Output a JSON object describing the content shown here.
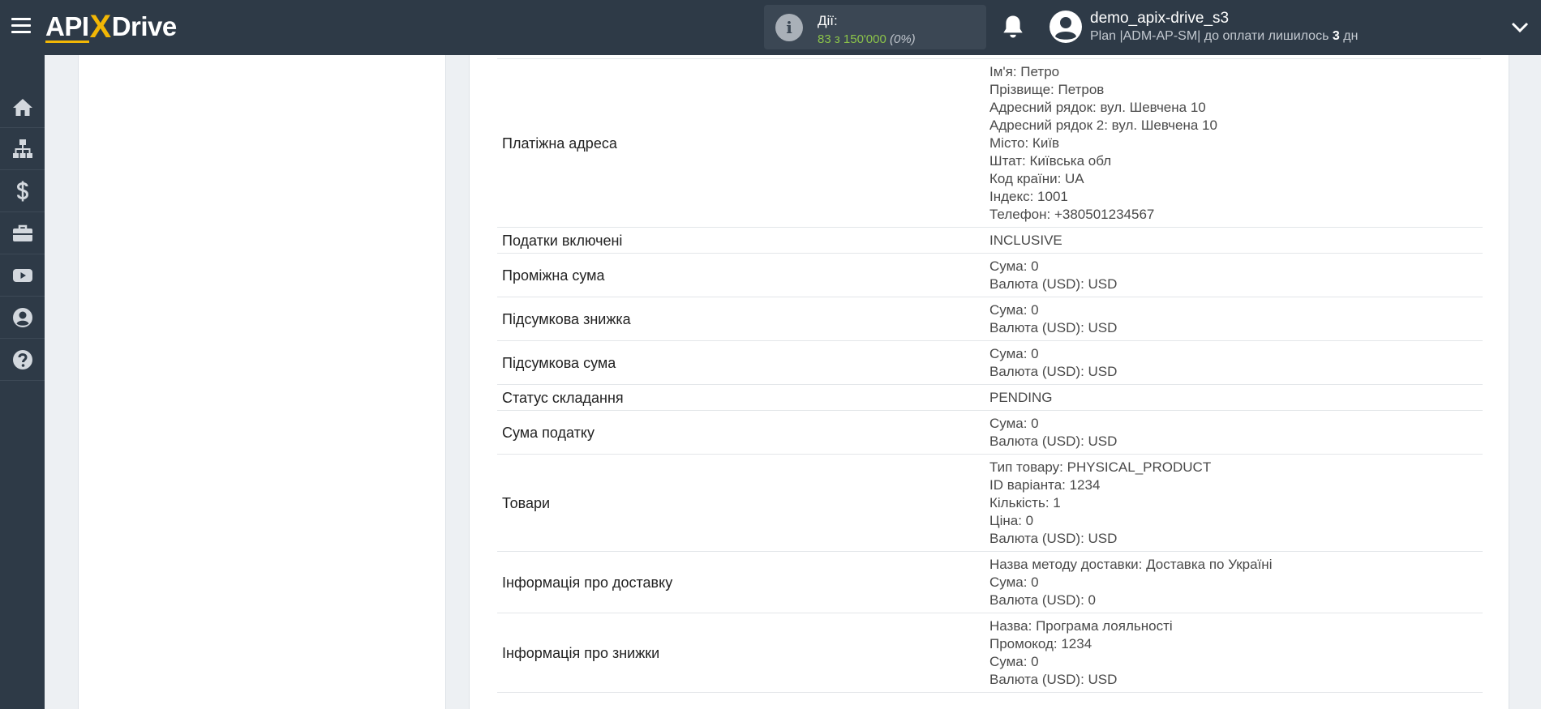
{
  "header": {
    "logo_left": "API",
    "logo_x": "X",
    "logo_right": "Drive",
    "actions_label": "Дії:",
    "actions_value": "83 з 150'000",
    "actions_percent": "(0%)",
    "username": "demo_apix-drive_s3",
    "plan_text": "Plan |ADM-AP-SM| до оплати лишилось",
    "plan_days": "3",
    "plan_suffix": "дн"
  },
  "sidebar": {
    "items": [
      {
        "icon": "home-icon"
      },
      {
        "icon": "sitemap-icon"
      },
      {
        "icon": "dollar-icon"
      },
      {
        "icon": "briefcase-icon"
      },
      {
        "icon": "youtube-icon"
      },
      {
        "icon": "user-circle-icon"
      },
      {
        "icon": "help-icon"
      }
    ]
  },
  "rows": [
    {
      "label": "Платіжна адреса",
      "values": [
        "Ім'я: Петро",
        "Прізвище: Петров",
        "Адресний рядок: вул. Шевчена 10",
        "Адресний рядок 2: вул. Шевчена 10",
        "Місто: Київ",
        "Штат: Київська обл",
        "Код країни: UA",
        "Індекс: 1001",
        "Телефон: +380501234567"
      ]
    },
    {
      "label": "Податки включені",
      "values": [
        "INCLUSIVE"
      ]
    },
    {
      "label": "Проміжна сума",
      "values": [
        "Сума: 0",
        "Валюта (USD): USD"
      ]
    },
    {
      "label": "Підсумкова знижка",
      "values": [
        "Сума: 0",
        "Валюта (USD): USD"
      ]
    },
    {
      "label": "Підсумкова сума",
      "values": [
        "Сума: 0",
        "Валюта (USD): USD"
      ]
    },
    {
      "label": "Статус складання",
      "values": [
        "PENDING"
      ]
    },
    {
      "label": "Сума податку",
      "values": [
        "Сума: 0",
        "Валюта (USD): USD"
      ]
    },
    {
      "label": "Товари",
      "values": [
        "Тип товару: PHYSICAL_PRODUCT",
        "ID варіанта: 1234",
        "Кількість: 1",
        "Ціна: 0",
        "Валюта (USD): USD"
      ]
    },
    {
      "label": "Інформація про доставку",
      "values": [
        "Назва методу доставки: Доставка по Україні",
        "Сума: 0",
        "Валюта (USD): 0"
      ]
    },
    {
      "label": "Інформація про знижки",
      "values": [
        "Назва: Програма лояльності",
        "Промокод: 1234",
        "Сума: 0",
        "Валюта (USD): USD"
      ]
    }
  ],
  "colors": {
    "header_bg": "#2e3a47",
    "accent_yellow": "#f2b705",
    "actions_green": "#8bc34a",
    "page_bg": "#edf0f3"
  }
}
